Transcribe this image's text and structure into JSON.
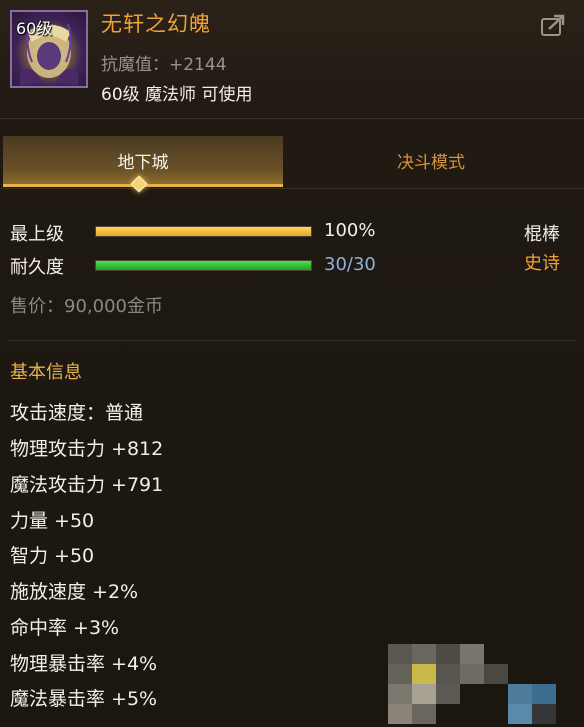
{
  "header": {
    "level_tag": "60级",
    "item_name": "无轩之幻魄",
    "resist_text": "抗魔值：+2144",
    "requirement": "60级 魔法师 可使用"
  },
  "tabs": [
    {
      "label": "地下城",
      "active": true
    },
    {
      "label": "决斗模式",
      "active": false
    }
  ],
  "grade": {
    "label": "最上级",
    "value_text": "100%",
    "fraction": 1.0
  },
  "durability": {
    "label": "耐久度",
    "value_text": "30/30",
    "fraction": 1.0
  },
  "weapon_type": "棍棒",
  "rarity": "史诗",
  "price": "售价：90,000金币",
  "basic_info": {
    "title": "基本信息",
    "stats": [
      "攻击速度：普通",
      "物理攻击力 +812",
      "魔法攻击力 +791",
      "力量 +50",
      "智力 +50",
      "施放速度 +2%",
      "命中率 +3%",
      "物理暴击率 +4%",
      "魔法暴击率 +5%"
    ]
  },
  "colors": {
    "item_name": "#f0a23a",
    "section_title": "#e9b24a",
    "grade_bar": "#f2c040",
    "durability_bar": "#3fcf3f",
    "durability_text": "#8fb0d8"
  }
}
